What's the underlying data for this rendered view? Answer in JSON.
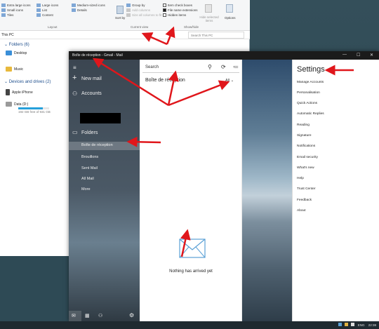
{
  "explorer": {
    "ribbon": {
      "layout_col1": [
        "Extra large icons",
        "Small icons",
        "Tiles"
      ],
      "layout_col2": [
        "Large icons",
        "List",
        "Content"
      ],
      "layout_col3": [
        "Medium-sized icons",
        "Details"
      ],
      "layout_group": "Layout",
      "sort_by": "Sort by",
      "current_view_items": [
        "Group by",
        "Add columns",
        "Size all columns to fit"
      ],
      "current_view_group": "Current view",
      "checkboxes": [
        {
          "label": "Item check boxes",
          "checked": false
        },
        {
          "label": "File name extensions",
          "checked": true
        },
        {
          "label": "Hidden items",
          "checked": false
        }
      ],
      "hide_selected": "Hide selected items",
      "options": "Options",
      "showhide_group": "Show/hide"
    },
    "address": "This PC",
    "search_placeholder": "Search This PC",
    "folders_header": "Folders (6)",
    "folders": [
      "Desktop",
      "Music"
    ],
    "devices_header": "Devices and drives (2)",
    "devices": [
      {
        "name": "Apple iPhone",
        "detail": ""
      },
      {
        "name": "Data (D:)",
        "detail": "192 GB free of 931 GB"
      }
    ]
  },
  "mail": {
    "title": "Boîte de réception - Gmail - Mail",
    "nav": {
      "new_mail": "New mail",
      "accounts": "Accounts",
      "folders": "Folders",
      "folder_items": [
        "Boîte de réception",
        "Brouillons",
        "Sent Mail",
        "All Mail",
        "More"
      ]
    },
    "list": {
      "search_placeholder": "Search",
      "folder_title": "Boîte de réception",
      "filter": "All",
      "empty_message": "Nothing has arrived yet"
    },
    "settings": {
      "title": "Settings",
      "items": [
        "Manage Accounts",
        "Personalisation",
        "Quick Actions",
        "Automatic Replies",
        "Reading",
        "Signature",
        "Notifications",
        "Email security",
        "What's new",
        "Help",
        "Trust Center",
        "Feedback",
        "About"
      ]
    }
  },
  "taskbar": {
    "tray_text": "ENG",
    "time": "22:38"
  },
  "colors": {
    "arrow": "#e0161b",
    "mail_accent": "#0f6ab4",
    "settings_link": "#106ebe"
  }
}
